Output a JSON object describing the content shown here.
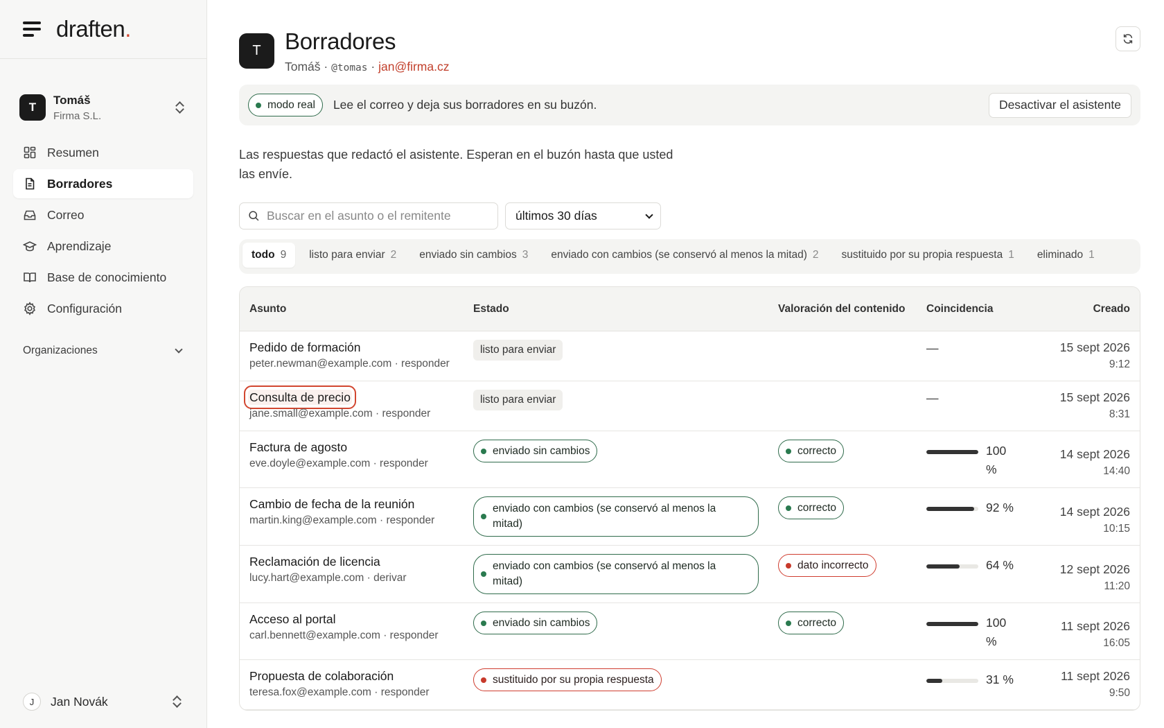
{
  "brand": {
    "logo": "draften",
    "logo_dot": "."
  },
  "account": {
    "initial": "T",
    "name": "Tomáš",
    "org": "Firma S.L."
  },
  "nav": {
    "items": [
      {
        "label": "Resumen",
        "icon": "grid-icon"
      },
      {
        "label": "Borradores",
        "icon": "document-icon",
        "active": true
      },
      {
        "label": "Correo",
        "icon": "inbox-icon"
      },
      {
        "label": "Aprendizaje",
        "icon": "graduation-cap-icon"
      },
      {
        "label": "Base de conocimiento",
        "icon": "book-icon"
      },
      {
        "label": "Configuración",
        "icon": "gear-icon"
      }
    ],
    "organizations_label": "Organizaciones"
  },
  "user": {
    "initial": "J",
    "name": "Jan Novák"
  },
  "header": {
    "initial": "T",
    "title": "Borradores",
    "name": "Tomáš",
    "separator": "·",
    "handle": "@tomas",
    "email": "jan@firma.cz"
  },
  "banner": {
    "mode_label": "modo real",
    "message": "Lee el correo y deja sus borradores en su buzón.",
    "deactivate_label": "Desactivar el asistente"
  },
  "description": "Las respuestas que redactó el asistente. Esperan en el buzón hasta que usted las envíe.",
  "search": {
    "placeholder": "Buscar en el asunto o el remitente"
  },
  "period": {
    "selected": "últimos 30 días"
  },
  "tabs": [
    {
      "label": "todo",
      "count": "9"
    },
    {
      "label": "listo para enviar",
      "count": "2"
    },
    {
      "label": "enviado sin cambios",
      "count": "3"
    },
    {
      "label": "enviado con cambios (se conservó al menos la mitad)",
      "count": "2"
    },
    {
      "label": "sustituido por su propia respuesta",
      "count": "1"
    },
    {
      "label": "eliminado",
      "count": "1"
    }
  ],
  "table": {
    "columns": {
      "subject": "Asunto",
      "status": "Estado",
      "rating": "Valoración del contenido",
      "match": "Coincidencia",
      "created": "Creado"
    },
    "rows": [
      {
        "subject": "Pedido de formación",
        "from": "peter.newman@example.com · responder",
        "status": "listo para enviar",
        "status_kind": "gray",
        "rating": "",
        "rating_kind": "",
        "match": "—",
        "match_value": null,
        "date": "15 sept 2026",
        "time": "9:12"
      },
      {
        "subject": "Consulta de precio",
        "from": "jane.small@example.com · responder",
        "status": "listo para enviar",
        "status_kind": "gray",
        "rating": "",
        "rating_kind": "",
        "match": "—",
        "match_value": null,
        "date": "15 sept 2026",
        "time": "8:31"
      },
      {
        "subject": "Factura de agosto",
        "from": "eve.doyle@example.com · responder",
        "status": "enviado sin cambios",
        "status_kind": "green",
        "rating": "correcto",
        "rating_kind": "green",
        "match": "100 %",
        "match_value": 100,
        "date": "14 sept 2026",
        "time": "14:40"
      },
      {
        "subject": "Cambio de fecha de la reunión",
        "from": "martin.king@example.com · responder",
        "status": "enviado con cambios (se conservó al menos la mitad)",
        "status_kind": "green",
        "rating": "correcto",
        "rating_kind": "green",
        "match": "92 %",
        "match_value": 92,
        "date": "14 sept 2026",
        "time": "10:15"
      },
      {
        "subject": "Reclamación de licencia",
        "from": "lucy.hart@example.com · derivar",
        "status": "enviado con cambios (se conservó al menos la mitad)",
        "status_kind": "green",
        "rating": "dato incorrecto",
        "rating_kind": "red",
        "match": "64 %",
        "match_value": 64,
        "date": "12 sept 2026",
        "time": "11:20"
      },
      {
        "subject": "Acceso al portal",
        "from": "carl.bennett@example.com · responder",
        "status": "enviado sin cambios",
        "status_kind": "green",
        "rating": "correcto",
        "rating_kind": "green",
        "match": "100 %",
        "match_value": 100,
        "date": "11 sept 2026",
        "time": "16:05"
      },
      {
        "subject": "Propuesta de colaboración",
        "from": "teresa.fox@example.com · responder",
        "status": "sustituido por su propia respuesta",
        "status_kind": "red",
        "rating": "",
        "rating_kind": "",
        "match": "31 %",
        "match_value": 31,
        "date": "11 sept 2026",
        "time": "9:50"
      }
    ]
  },
  "colors": {
    "accent": "#d2462f",
    "green": "#2a7a4f",
    "red": "#c73a2b",
    "email": "#c2402c"
  }
}
